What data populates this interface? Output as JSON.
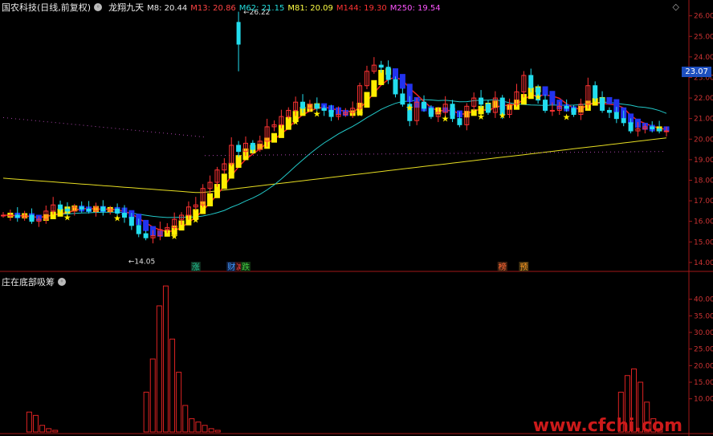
{
  "header": {
    "stock": "国农科技(日线,前复权)",
    "indicator": "龙翔九天",
    "ma": [
      {
        "label": "M8:",
        "value": "20.44",
        "color": "#e8e8e8"
      },
      {
        "label": "M13:",
        "value": "20.86",
        "color": "#ff4444"
      },
      {
        "label": "M62:",
        "value": "21.15",
        "color": "#22dddd"
      },
      {
        "label": "M81:",
        "value": "20.09",
        "color": "#ffff44"
      },
      {
        "label": "M144:",
        "value": "19.30",
        "color": "#ff3333"
      },
      {
        "label": "M250:",
        "value": "19.54",
        "color": "#ff55ff"
      }
    ]
  },
  "sub_header": {
    "title": "庄在底部吸筹"
  },
  "current_price": "23.07",
  "watermark": "www.cfchi.com",
  "chart_data": [
    {
      "type": "candlestick",
      "ylim": [
        13.8,
        26.3
      ],
      "y_ticks": [
        14.0,
        15.0,
        16.0,
        17.0,
        18.0,
        19.0,
        20.0,
        21.0,
        22.0,
        23.0,
        24.0,
        25.0,
        26.0
      ],
      "annotations": [
        {
          "text": "26.22",
          "value": 26.22
        },
        {
          "text": "14.05",
          "value": 14.05
        }
      ],
      "markers": [
        "涨",
        "财",
        "减",
        "跌",
        "榜",
        "预"
      ],
      "closes": [
        16.3,
        16.3,
        16.2,
        16.3,
        16.0,
        16.1,
        16.5,
        16.8,
        16.6,
        16.5,
        16.7,
        16.6,
        16.5,
        16.7,
        16.5,
        16.6,
        16.4,
        16.2,
        15.8,
        15.4,
        15.2,
        15.3,
        15.6,
        15.7,
        16.1,
        16.3,
        16.7,
        16.8,
        17.6,
        17.9,
        18.5,
        18.8,
        19.7,
        19.4,
        19.8,
        19.5,
        19.9,
        20.6,
        20.7,
        21.1,
        21.4,
        21.8,
        21.5,
        21.7,
        21.5,
        21.4,
        21.1,
        21.2,
        21.3,
        21.5,
        22.6,
        23.3,
        23.6,
        23.5,
        22.9,
        22.2,
        21.7,
        20.9,
        21.8,
        21.5,
        21.1,
        21.3,
        21.7,
        21.0,
        20.7,
        21.6,
        22.0,
        21.7,
        21.3,
        22.0,
        21.2,
        21.7,
        22.3,
        23.1,
        22.5,
        21.9,
        21.4,
        21.4,
        21.6,
        21.5,
        21.2,
        21.7,
        22.6,
        22.0,
        21.4,
        21.3,
        21.0,
        20.8,
        20.4,
        20.5,
        20.6,
        20.5,
        20.4,
        20.4
      ],
      "cross_ma": [
        {
          "name": "M144",
          "color": "#ee2222"
        },
        {
          "name": "M81",
          "color": "#e6dd22"
        },
        {
          "name": "M62",
          "color": "#22c8c8"
        },
        {
          "name": "M13",
          "color": "#ee2222"
        }
      ]
    },
    {
      "type": "bar",
      "ylim": [
        0,
        45
      ],
      "y_ticks": [
        10.0,
        15.0,
        20.0,
        25.0,
        30.0,
        35.0,
        40.0
      ],
      "values": [
        0,
        0,
        0,
        0,
        6,
        5,
        2,
        1,
        0.5,
        0,
        0,
        0,
        0,
        0,
        0,
        0,
        0,
        0,
        0,
        0,
        0,
        0,
        12,
        22,
        38,
        44,
        28,
        18,
        8,
        4,
        3,
        2,
        1,
        0.5,
        0,
        0,
        0,
        0,
        0,
        0,
        0,
        0,
        0,
        0,
        0,
        0,
        0,
        0,
        0,
        0,
        0,
        0,
        0,
        0,
        0,
        0,
        0,
        0,
        0,
        0,
        0,
        0,
        0,
        0,
        0,
        0,
        0,
        0,
        0,
        0,
        0,
        0,
        0,
        0,
        0,
        0,
        0,
        0,
        0,
        0,
        0,
        0,
        0,
        0,
        0,
        0,
        0,
        0,
        0,
        0,
        0,
        0,
        0,
        0,
        0,
        12,
        17,
        19,
        15,
        9,
        4,
        1,
        0
      ]
    }
  ]
}
